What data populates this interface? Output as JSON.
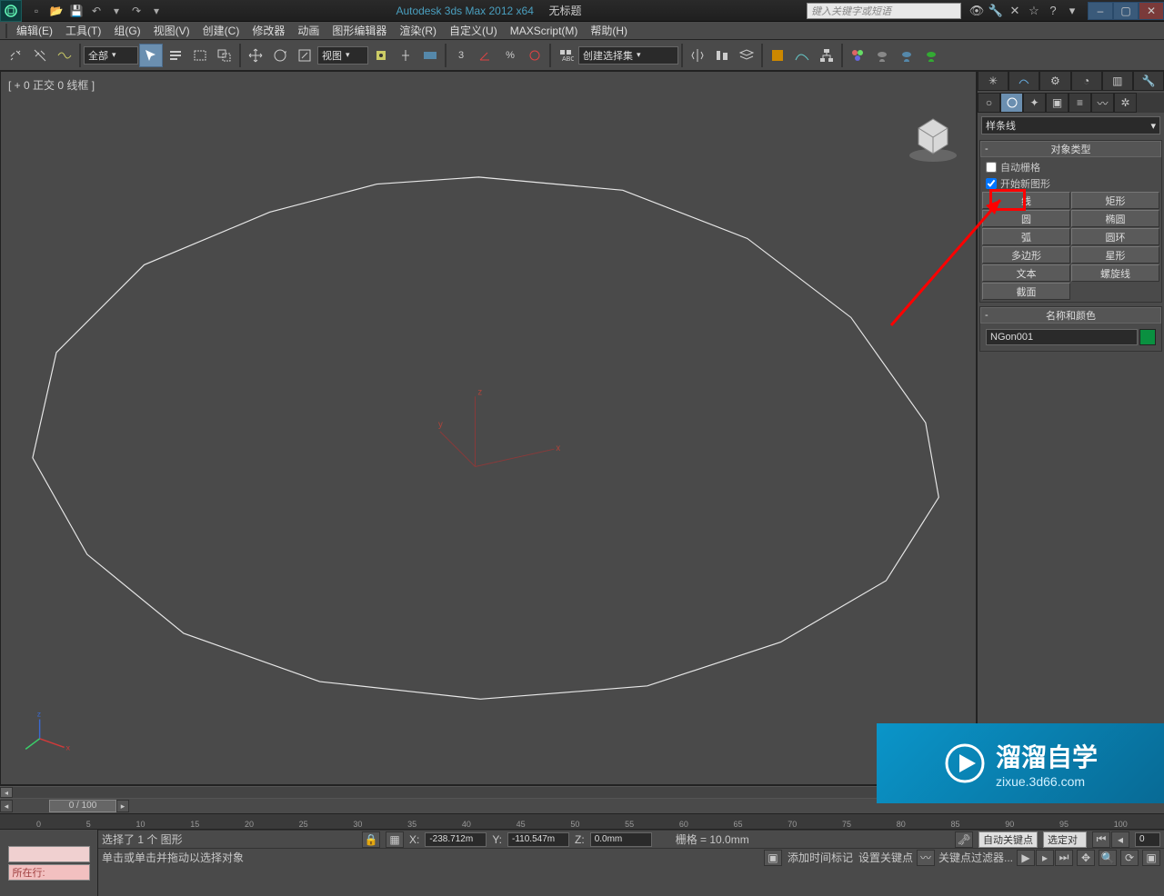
{
  "title": {
    "app": "Autodesk 3ds Max  2012 x64",
    "doc": "无标题"
  },
  "search_placeholder": "键入关键字或短语",
  "menus": [
    "编辑(E)",
    "工具(T)",
    "组(G)",
    "视图(V)",
    "创建(C)",
    "修改器",
    "动画",
    "图形编辑器",
    "渲染(R)",
    "自定义(U)",
    "MAXScript(M)",
    "帮助(H)"
  ],
  "toolbar": {
    "filter_all": "全部",
    "ref_coord": "视图",
    "named_set": "创建选择集"
  },
  "viewport_label": "[ + 0 正交 0 线框 ]",
  "cmd": {
    "category": "样条线",
    "rollout_type": "对象类型",
    "auto_grid": "自动栅格",
    "start_new": "开始新图形",
    "buttons": [
      [
        "线",
        "矩形"
      ],
      [
        "圆",
        "椭圆"
      ],
      [
        "弧",
        "圆环"
      ],
      [
        "多边形",
        "星形"
      ],
      [
        "文本",
        "螺旋线"
      ],
      [
        "截面",
        ""
      ]
    ],
    "rollout_name": "名称和颜色",
    "object_name": "NGon001"
  },
  "timeline": {
    "slider": "0 / 100",
    "ticks": [
      "0",
      "5",
      "10",
      "15",
      "20",
      "25",
      "30",
      "35",
      "40",
      "45",
      "50",
      "55",
      "60",
      "65",
      "70",
      "75",
      "80",
      "85",
      "90",
      "95",
      "100"
    ]
  },
  "status": {
    "sel_text": "选择了 1 个 图形",
    "hint_text": "单击或单击并拖动以选择对象",
    "locate_prefix": "所在行:",
    "x": "-238.712m",
    "y": "-110.547m",
    "z": "0.0mm",
    "grid": "栅格 = 10.0mm",
    "add_tag": "添加时间标记",
    "auto_key": "自动关键点",
    "set_key": "设置关键点",
    "sel_obj": "选定对",
    "key_filter": "关键点过滤器...",
    "frame": "0"
  },
  "coord_labels": {
    "x": "X:",
    "y": "Y:",
    "z": "Z:"
  },
  "watermark": {
    "brand": "溜溜自学",
    "url": "zixue.3d66.com"
  }
}
